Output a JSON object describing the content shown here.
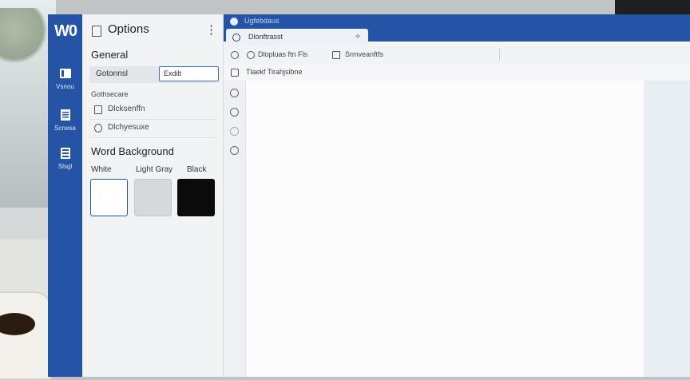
{
  "app": {
    "logo": "W0",
    "accent": "#2553a5"
  },
  "rail": {
    "items": [
      {
        "label": "Vsnou",
        "icon": "document-icon"
      },
      {
        "label": "Scnesa",
        "icon": "notebook-icon"
      },
      {
        "label": "Slsgl",
        "icon": "layout-icon"
      }
    ]
  },
  "options": {
    "title": "Options",
    "title_icon": "panel-icon",
    "more_icon": "more-vertical-icon",
    "general_heading": "General",
    "general_row": {
      "label": "Gotonnsl",
      "value": "Exdilt"
    },
    "sub_label": "Gothsecare",
    "items": [
      {
        "label": "Dlcksenffn",
        "icon": "page-icon"
      },
      {
        "label": "Dlchyesuxe",
        "icon": "clock-icon"
      }
    ],
    "background_heading": "Word Background",
    "swatches": [
      {
        "label": "White",
        "color": "#ffffff"
      },
      {
        "label": "Light Gray",
        "color": "#d7d8d9"
      },
      {
        "label": "Black",
        "color": "#0b0b0b"
      }
    ]
  },
  "document": {
    "titlebar_text": "Ugfebdaus",
    "tab_label": "Dlonftrasst",
    "tab_pin": "⟡",
    "toolbar": [
      {
        "label": "Dlopluas ftn Fls",
        "icon": "circle-icon"
      },
      {
        "label": "Srmveanftfs",
        "icon": "page-icon"
      }
    ],
    "ribbon_label": "Tlaekf Tirahjsibne"
  }
}
